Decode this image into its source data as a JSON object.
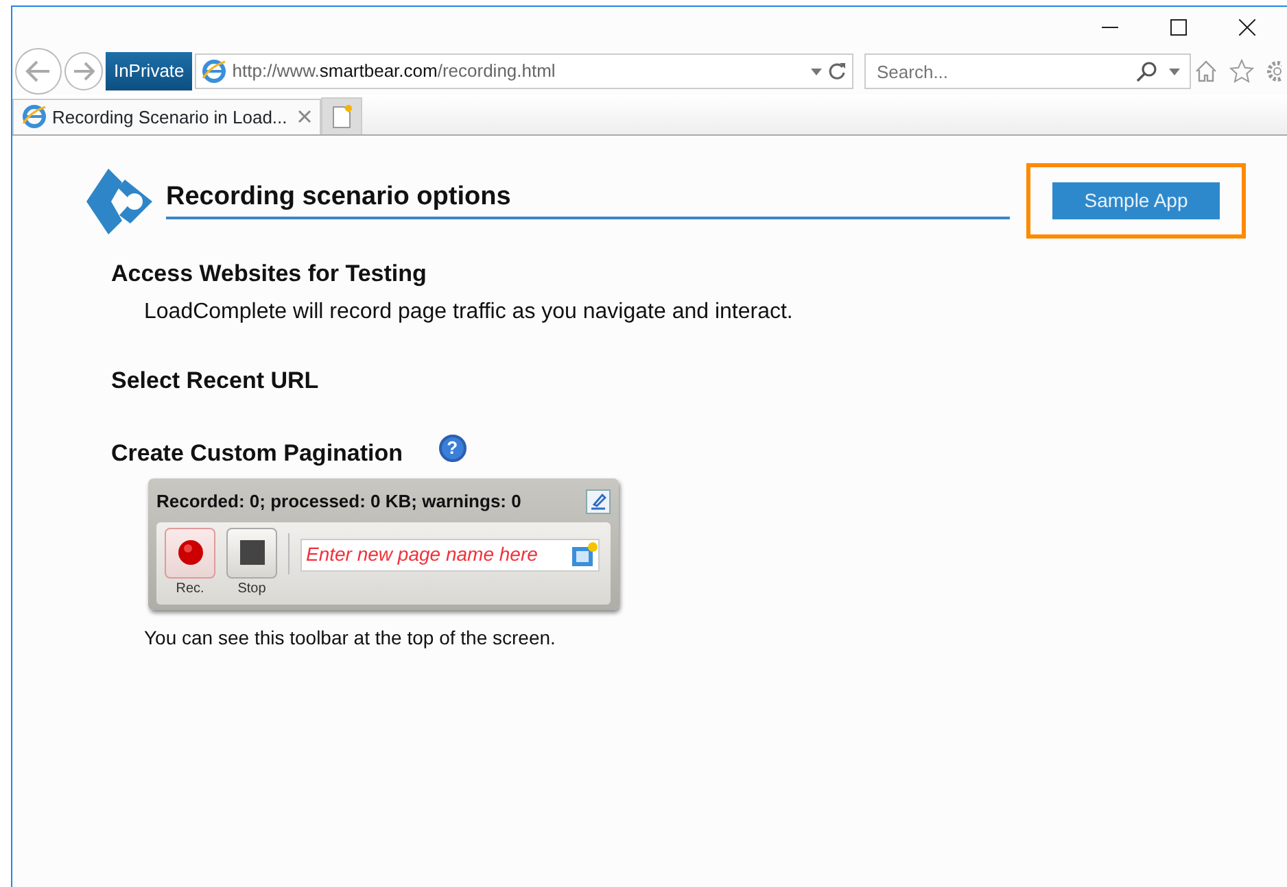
{
  "browser": {
    "inprivate": "InPrivate",
    "address": "http://www.**smartbear.com**/recording.html",
    "search": {
      "placeholder": "Search..."
    },
    "tabs": [
      {
        "label": "Recording Scenario in Load...",
        "selected": true
      }
    ]
  },
  "page": {
    "title": "Recording scenario options",
    "sample_button": {
      "label": "Sample App",
      "highlighted": true
    },
    "sections": [
      {
        "heading": "Access Websites for Testing",
        "text": "LoadComplete will record page traffic as you navigate and interact."
      },
      {
        "heading": "Select Recent URL"
      },
      {
        "heading": "Create Custom Pagination",
        "help": "?"
      }
    ],
    "toolbar": {
      "status": "Recorded: 0; processed: 0 KB; warnings: 0",
      "buttons": [
        {
          "kind": "record",
          "label": "Rec.",
          "selected": true
        },
        {
          "kind": "stop",
          "label": "Stop",
          "selected": false
        }
      ],
      "page_name": {
        "placeholder": "Enter new page name here"
      }
    },
    "caption": "You can see this toolbar at the top of the screen."
  }
}
